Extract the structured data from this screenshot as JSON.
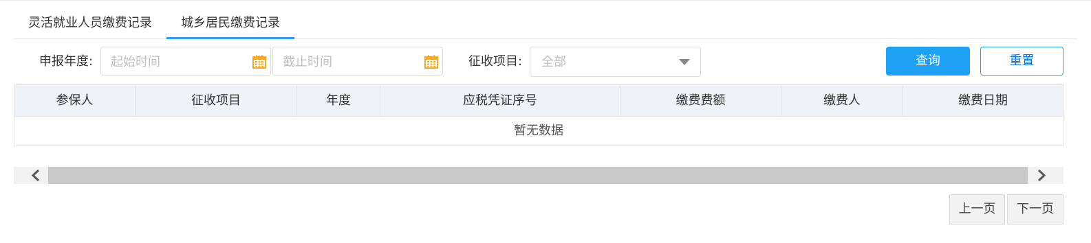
{
  "tabs": [
    {
      "label": "灵活就业人员缴费记录",
      "active": false
    },
    {
      "label": "城乡居民缴费记录",
      "active": true
    }
  ],
  "filters": {
    "year_label": "申报年度:",
    "start_placeholder": "起始时间",
    "end_placeholder": "截止时间",
    "item_label": "征收项目:",
    "item_value": "全部"
  },
  "buttons": {
    "query": "查询",
    "reset": "重置"
  },
  "table": {
    "columns": [
      "参保人",
      "征收项目",
      "年度",
      "应税凭证序号",
      "缴费费额",
      "缴费人",
      "缴费日期"
    ],
    "empty_text": "暂无数据"
  },
  "pagination": {
    "prev": "上一页",
    "next": "下一页"
  },
  "colors": {
    "accent": "#1ea0f5",
    "calendar_icon": "#f5a623"
  }
}
